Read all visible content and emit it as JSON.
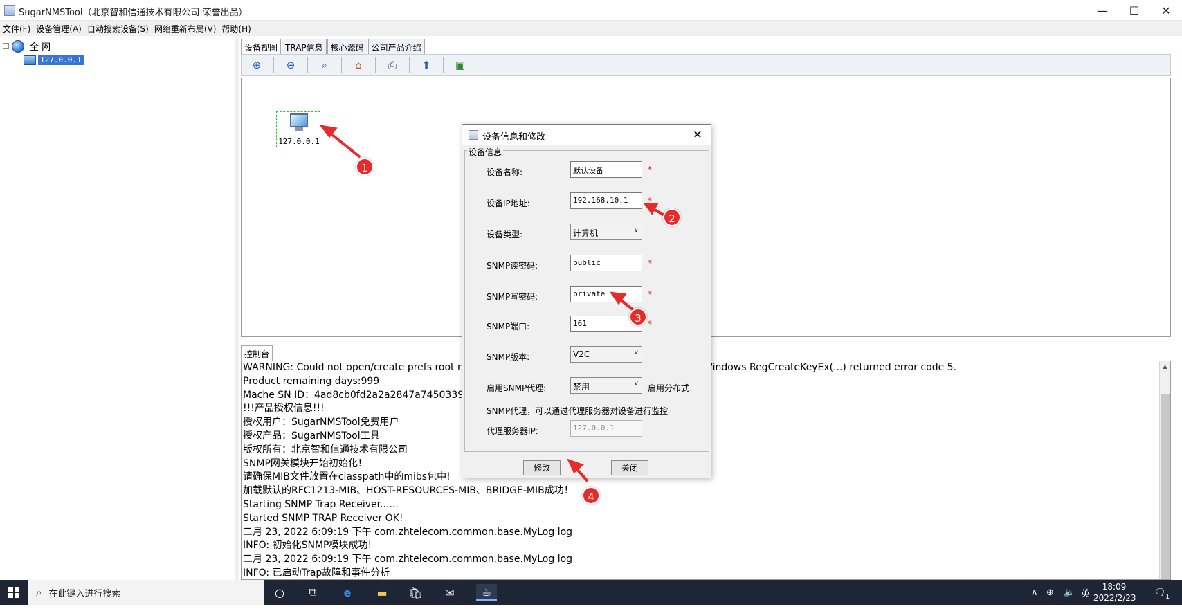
{
  "window": {
    "title": "SugarNMSTool（北京智和信通技术有限公司 荣誉出品）",
    "minimize": "—",
    "maximize": "☐",
    "close": "✕"
  },
  "menu": {
    "items": [
      "文件(F)",
      "设备管理(A)",
      "自动搜索设备(S)",
      "网络重新布局(V)",
      "帮助(H)"
    ]
  },
  "tree": {
    "root_label": "全  网",
    "node_label": "127.0.0.1"
  },
  "tabs": [
    "设备视图",
    "TRAP信息",
    "核心源码",
    "公司产品介绍"
  ],
  "toolbar": {
    "icons": [
      "zoom-in-icon",
      "zoom-out-icon",
      "zoom-fit-icon",
      "home-icon",
      "print-icon",
      "refresh-icon",
      "add-device-icon"
    ]
  },
  "canvas": {
    "device_label": "127.0.0.1"
  },
  "console": {
    "tab_label": "控制台",
    "lines": [
      "WARNING: Could not open/create prefs root node Software\\JavaSoft\\Prefs at root 0x80000002. Windows RegCreateKeyEx(...) returned error code 5.",
      "Product remaining days:999",
      "Mache SN ID：4ad8cb0fd2a2a2847a74503393505",
      "!!!产品授权信息!!!",
      "授权用户：SugarNMSTool免费用户",
      "授权产品：SugarNMSTool工具",
      "版权所有：北京智和信通技术有限公司",
      "SNMP网关模块开始初始化！",
      "请确保MIB文件放置在classpath中的mibs包中!",
      "加载默认的RFC1213-MIB、HOST-RESOURCES-MIB、BRIDGE-MIB成功！",
      "Starting SNMP Trap Receiver......",
      "Started SNMP TRAP Receiver OK!",
      "二月 23, 2022 6:09:19 下午 com.zhtelecom.common.base.MyLog log",
      "INFO: 初始化SNMP模块成功!",
      "二月 23, 2022 6:09:19 下午 com.zhtelecom.common.base.MyLog log",
      "INFO: 已启动Trap故障和事件分析"
    ]
  },
  "dialog": {
    "title": "设备信息和修改",
    "group_title": "设备信息",
    "close": "✕",
    "fields": {
      "name_label": "设备名称:",
      "name_value": "默认设备",
      "ip_label": "设备IP地址:",
      "ip_value": "192.168.10.1",
      "type_label": "设备类型:",
      "type_value": "计算机",
      "read_label": "SNMP读密码:",
      "read_value": "public",
      "write_label": "SNMP写密码:",
      "write_value": "private",
      "port_label": "SNMP端口:",
      "port_value": "161",
      "version_label": "SNMP版本:",
      "version_value": "V2C",
      "proxy_label": "启用SNMP代理:",
      "proxy_value": "禁用",
      "distributed_label": "启用分布式",
      "proxy_hint": "SNMP代理，可以通过代理服务器对设备进行监控",
      "proxy_ip_label": "代理服务器IP:",
      "proxy_ip_value": "127.0.0.1"
    },
    "required_mark": "*",
    "modify_button": "修改",
    "close_button": "关闭"
  },
  "annotations": [
    "1",
    "2",
    "3",
    "4"
  ],
  "taskbar": {
    "search_placeholder": "在此键入进行搜索",
    "ime": "英",
    "time": "18:09",
    "date": "2022/2/23",
    "notification_count": "1"
  },
  "colors": {
    "accent": "#3875d7",
    "annotation": "#e52b2b",
    "device_selection": "#25c425",
    "required": "#e02020",
    "taskbar": "#1e2636"
  }
}
